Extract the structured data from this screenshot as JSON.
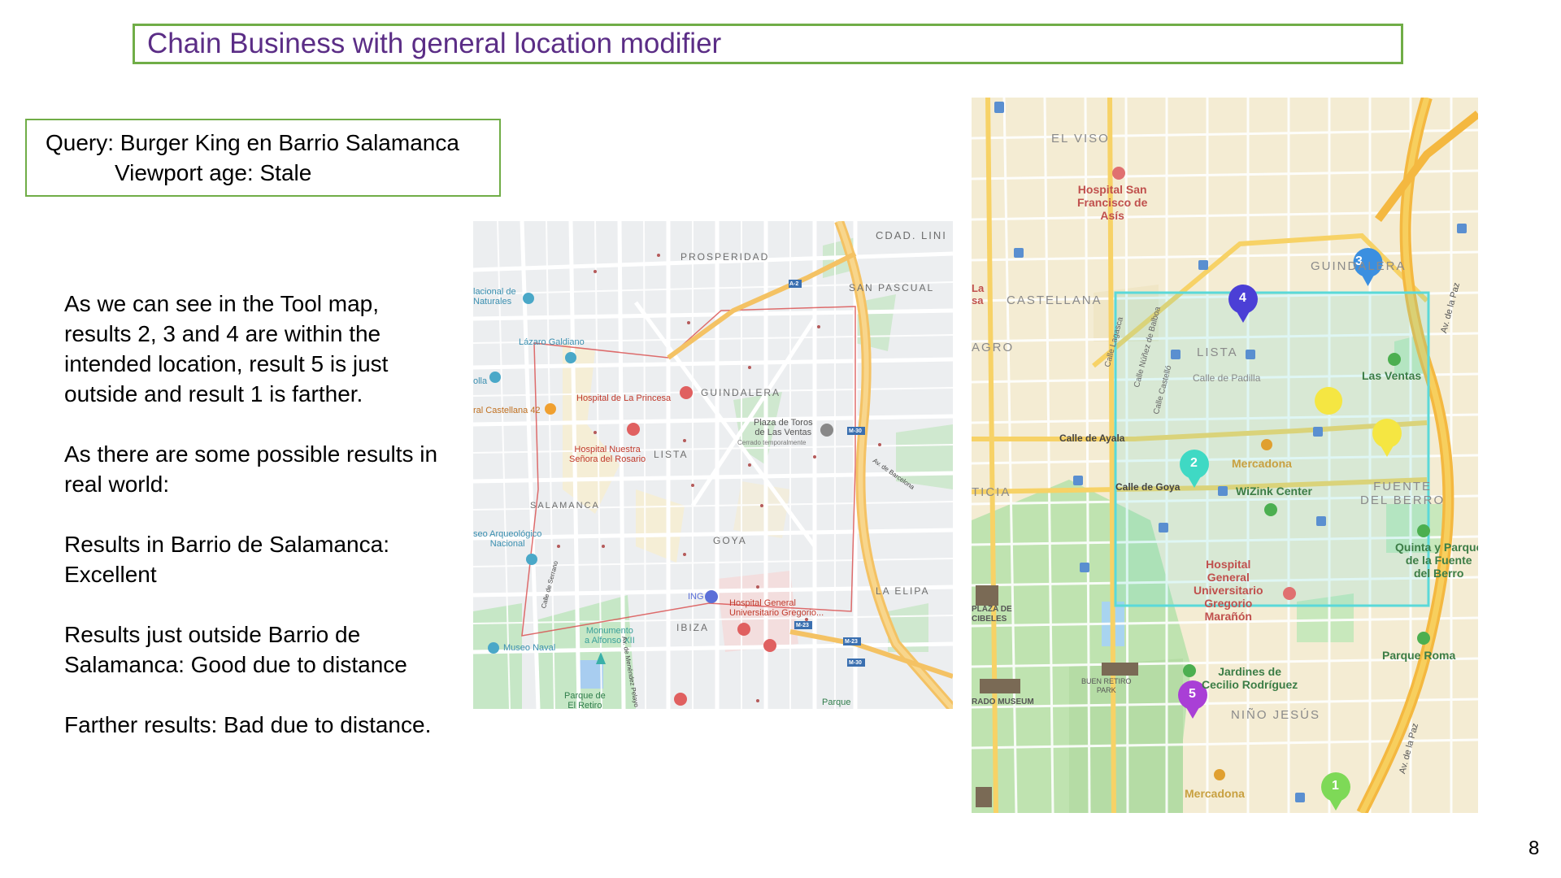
{
  "slide": {
    "title": "Chain Business with general location modifier",
    "query_line": "Query: Burger King en Barrio Salamanca",
    "viewport_line": "Viewport age: Stale",
    "paragraphs": [
      "As we can see in the Tool map, results 2, 3 and 4 are within the intended location, result 5 is just outside and result 1 is farther.",
      "As there are some possible results in real world:",
      "Results in Barrio de Salamanca: Excellent",
      "Results just outside Barrio de Salamanca: Good due to distance",
      "Farther results: Bad due to distance."
    ],
    "page_number": "8"
  },
  "left_map": {
    "districts": [
      "PROSPERIDAD",
      "CDAD. LINI",
      "SAN PASCUAL",
      "GUINDALERA",
      "LISTA",
      "SALAMANCA",
      "GOYA",
      "IBIZA",
      "LA ELIPA"
    ],
    "pois": {
      "museo_naturales": "lacional de\nNaturales",
      "lazaro": "Lázaro Galdiano",
      "colla": "olla",
      "castellana": "ral Castellana 42",
      "princesa": "Hospital de La Princesa",
      "rosario": "Hospital Nuestra\nSeñora del Rosario",
      "toros": "Plaza de Toros\nde Las Ventas",
      "toros_sub": "Cerrado temporalmente",
      "arqueologico": "seo Arqueológico\nNacional",
      "ing": "ING",
      "gregorio": "Hospital General\nUniversitario Gregorio...",
      "monumento": "Monumento\na Alfonso XII",
      "naval": "Museo Naval",
      "parque": "Parque de\nEl Retiro",
      "parque2": "Parque",
      "serrano": "Calle de Serrano",
      "menendez": "Av. de Menéndez Pelayo",
      "barcelona": "Av. de Barcelona"
    },
    "road_shields": [
      "M-30",
      "M-30",
      "M-23",
      "M-23",
      "A-2"
    ]
  },
  "right_map": {
    "districts": [
      "EL VISO",
      "GUINDALERA",
      "CASTELLANA",
      "LISTA",
      "AGRO",
      "TICIA",
      "FUENTE\nDEL BERRO",
      "NIÑO JESÚS",
      "La\nsa"
    ],
    "pois": {
      "san_francisco": "Hospital San\nFrancisco de\nAsís",
      "las_ventas": "Las Ventas",
      "mercadona1": "Mercadona",
      "wizink": "WiZink Center",
      "hospital": "Hospital\nGeneral\nUniversitario\nGregorio\nMarañón",
      "quinta": "Quinta y Parque\nde la Fuente\ndel Berro",
      "parque_roma": "Parque Roma",
      "jardines": "Jardines de\nCecilio Rodríguez",
      "mercadona2": "Mercadona",
      "plaza_cibeles": "PLAZA DE\nCIBELES",
      "buen_retiro": "BUEN RETIRO\nPARK",
      "prado": "RADO MUSEUM"
    },
    "streets": {
      "ayala": "Calle de Ayala",
      "goya": "Calle de Goya",
      "padilla": "Calle de Padilla",
      "lagasca": "Calle Lagasca",
      "nunez": "Calle Núñez de Balboa",
      "castello": "Calle Castelló",
      "avpaz1": "Av. de la Paz",
      "avpaz2": "Av. de la Paz"
    },
    "markers": [
      {
        "label": "1",
        "color": "#7ed957"
      },
      {
        "label": "2",
        "color": "#3fd9c4"
      },
      {
        "label": "3",
        "color": "#3b8fe0"
      },
      {
        "label": "4",
        "color": "#4b3fd6"
      },
      {
        "label": "5",
        "color": "#a93fd6"
      },
      {
        "label": "",
        "color": "#f5e642"
      }
    ],
    "viewport_color": "#5ad9d9"
  }
}
